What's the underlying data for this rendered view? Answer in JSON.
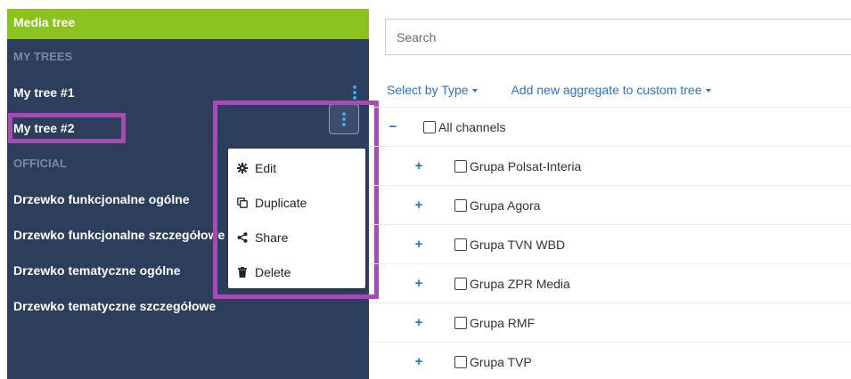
{
  "sidebar": {
    "header": "Media tree",
    "sections": {
      "my_trees": "MY TREES",
      "official": "OFFICIAL"
    },
    "my_trees": [
      {
        "label": "My tree #1"
      },
      {
        "label": "My tree #2"
      }
    ],
    "official_trees": [
      {
        "label": "Drzewko funkcjonalne ogólne"
      },
      {
        "label": "Drzewko funkcjonalne szczegółowe"
      },
      {
        "label": "Drzewko tematyczne ogólne"
      },
      {
        "label": "Drzewko tematyczne szczegółowe"
      }
    ]
  },
  "context_menu": {
    "items": [
      {
        "label": "Edit",
        "icon": "gear-icon"
      },
      {
        "label": "Duplicate",
        "icon": "duplicate-icon"
      },
      {
        "label": "Share",
        "icon": "share-icon"
      },
      {
        "label": "Delete",
        "icon": "trash-icon"
      }
    ]
  },
  "main": {
    "search_placeholder": "Search",
    "toolbar": {
      "select_by_type": "Select by Type",
      "add_aggregate": "Add new aggregate to custom tree"
    },
    "tree": {
      "root": {
        "toggle": "−",
        "label": "All channels"
      },
      "groups": [
        {
          "toggle": "+",
          "label": "Grupa Polsat-Interia"
        },
        {
          "toggle": "+",
          "label": "Grupa Agora"
        },
        {
          "toggle": "+",
          "label": "Grupa TVN WBD"
        },
        {
          "toggle": "+",
          "label": "Grupa ZPR Media"
        },
        {
          "toggle": "+",
          "label": "Grupa RMF"
        },
        {
          "toggle": "+",
          "label": "Grupa TVP"
        }
      ]
    }
  },
  "colors": {
    "sidebar_bg": "#2c3e5c",
    "header_green": "#8cc21e",
    "highlight_purple": "#a84ab5",
    "link_blue": "#2a73c9"
  }
}
